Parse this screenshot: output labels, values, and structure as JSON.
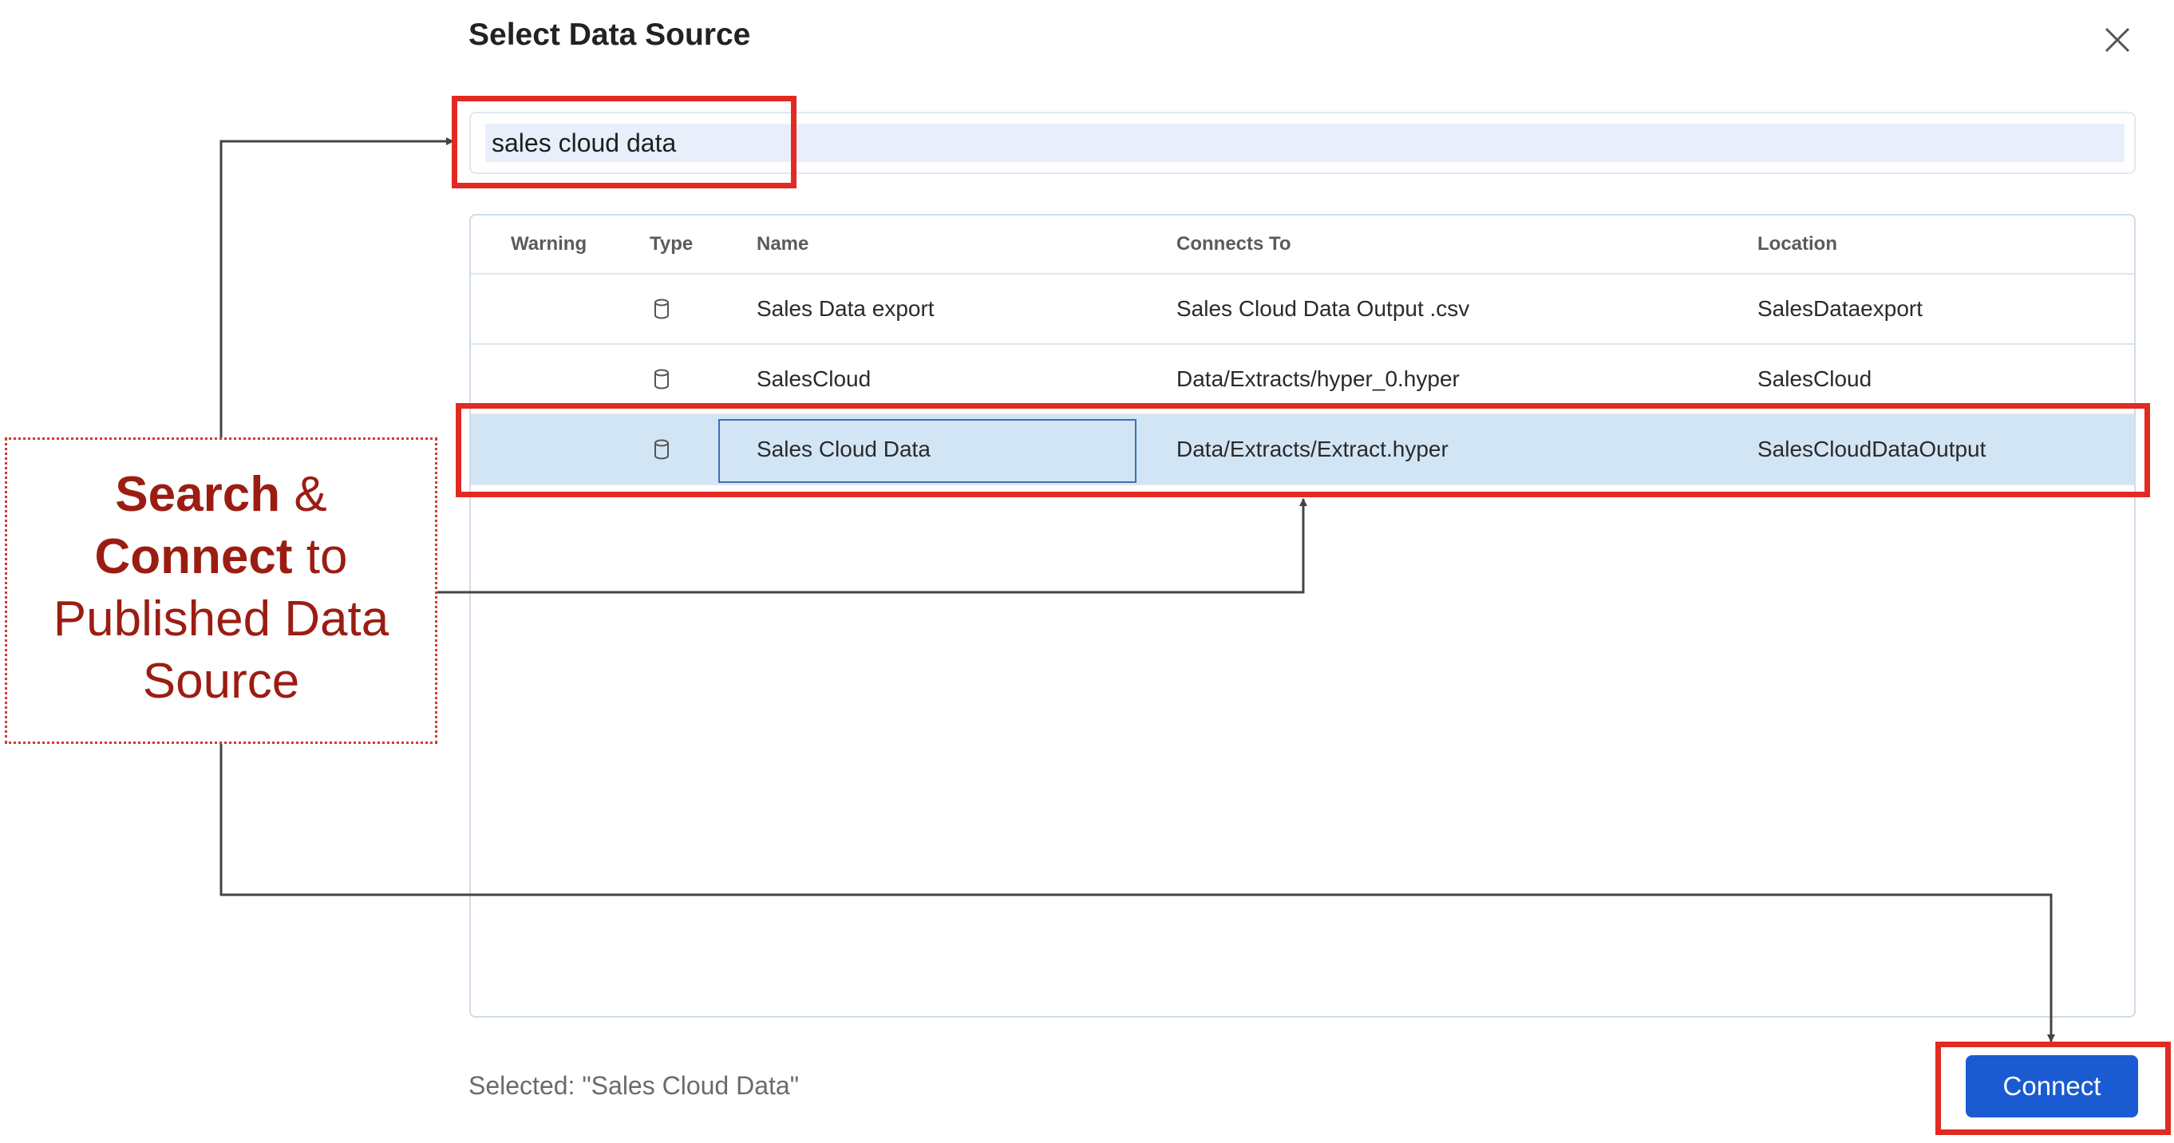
{
  "dialog": {
    "title": "Select Data Source",
    "close_icon": "close-icon"
  },
  "search": {
    "value": "sales cloud data"
  },
  "table": {
    "columns": [
      "Warning",
      "Type",
      "Name",
      "Connects To",
      "Location"
    ],
    "rows": [
      {
        "warning": "",
        "type_icon": "database-icon",
        "name": "Sales Data export",
        "connects_to": "Sales Cloud Data Output .csv",
        "location": "SalesDataexport"
      },
      {
        "warning": "",
        "type_icon": "database-icon",
        "name": "SalesCloud",
        "connects_to": "Data/Extracts/hyper_0.hyper",
        "location": "SalesCloud"
      },
      {
        "warning": "",
        "type_icon": "database-icon",
        "name": "Sales Cloud Data",
        "connects_to": "Data/Extracts/Extract.hyper",
        "location": "SalesCloudDataOutput",
        "selected": true
      }
    ]
  },
  "footer": {
    "selected_text": "Selected: \"Sales Cloud Data\"",
    "connect_label": "Connect"
  },
  "annotation": {
    "word1": "Search",
    "amp": "&",
    "word2": "Connect",
    "to": "to",
    "line3": "Published Data",
    "line4": "Source"
  },
  "colors": {
    "highlight_red": "#e22a22",
    "callout_text": "#9b1d12",
    "selected_row": "#d2e5f5",
    "primary_button": "#1a5bd2"
  }
}
